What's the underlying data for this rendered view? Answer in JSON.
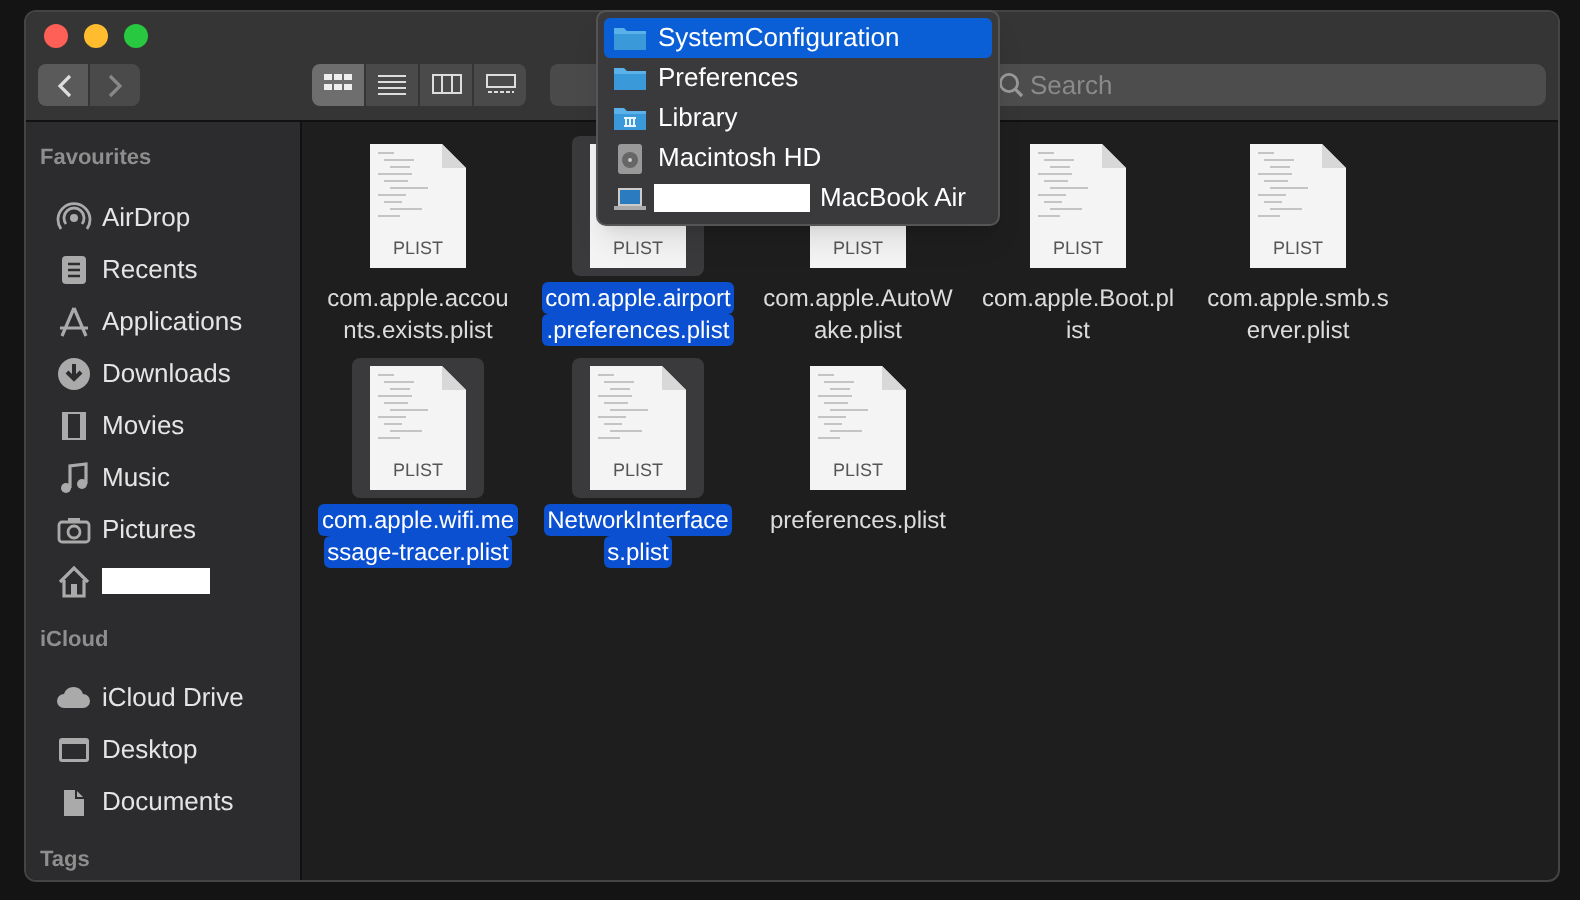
{
  "sidebar": {
    "sections": [
      {
        "title": "Favourites",
        "items": [
          {
            "kind": "airdrop",
            "label": "AirDrop"
          },
          {
            "kind": "recents",
            "label": "Recents"
          },
          {
            "kind": "applications",
            "label": "Applications"
          },
          {
            "kind": "downloads",
            "label": "Downloads"
          },
          {
            "kind": "movies",
            "label": "Movies"
          },
          {
            "kind": "music",
            "label": "Music"
          },
          {
            "kind": "pictures",
            "label": "Pictures"
          },
          {
            "kind": "home"
          }
        ]
      },
      {
        "title": "iCloud",
        "items": [
          {
            "kind": "cloud",
            "label": "iCloud Drive"
          },
          {
            "kind": "desktop",
            "label": "Desktop"
          },
          {
            "kind": "documents",
            "label": "Documents"
          }
        ]
      },
      {
        "title": "Tags"
      }
    ]
  },
  "toolbar": {
    "views": [
      {
        "kind": "icons",
        "selected": true
      },
      {
        "kind": "list",
        "selected": false
      },
      {
        "kind": "columns",
        "selected": false
      },
      {
        "kind": "gallery",
        "selected": false
      }
    ],
    "search": {
      "placeholder": "Search"
    }
  },
  "path_menu": [
    {
      "kind": "folder",
      "label": "SystemConfiguration",
      "selected": true
    },
    {
      "kind": "folder",
      "label": "Preferences",
      "selected": false
    },
    {
      "kind": "library",
      "label": "Library",
      "selected": false
    },
    {
      "kind": "disk",
      "label": "Macintosh HD",
      "selected": false
    },
    {
      "kind": "laptop",
      "label": "MacBook Air",
      "selected": false
    }
  ],
  "files": [
    {
      "badge": "PLIST",
      "name_lines": [
        "com.apple.accou",
        "nts.exists.plist"
      ],
      "selected": false
    },
    {
      "badge": "PLIST",
      "name_lines": [
        "com.apple.airport",
        ".preferences.plist"
      ],
      "selected": true
    },
    {
      "badge": "PLIST",
      "name_lines": [
        "com.apple.AutoW",
        "ake.plist"
      ],
      "selected": false
    },
    {
      "badge": "PLIST",
      "name_lines": [
        "com.apple.Boot.pl",
        "ist"
      ],
      "selected": false
    },
    {
      "badge": "PLIST",
      "name_lines": [
        "com.apple.smb.s",
        "erver.plist"
      ],
      "selected": false
    },
    {
      "badge": "PLIST",
      "name_lines": [
        "com.apple.wifi.me",
        "ssage-tracer.plist"
      ],
      "selected": true
    },
    {
      "badge": "PLIST",
      "name_lines": [
        "NetworkInterface",
        "s.plist"
      ],
      "selected": true
    },
    {
      "badge": "PLIST",
      "name_lines": [
        "preferences.plist"
      ],
      "selected": false
    }
  ]
}
